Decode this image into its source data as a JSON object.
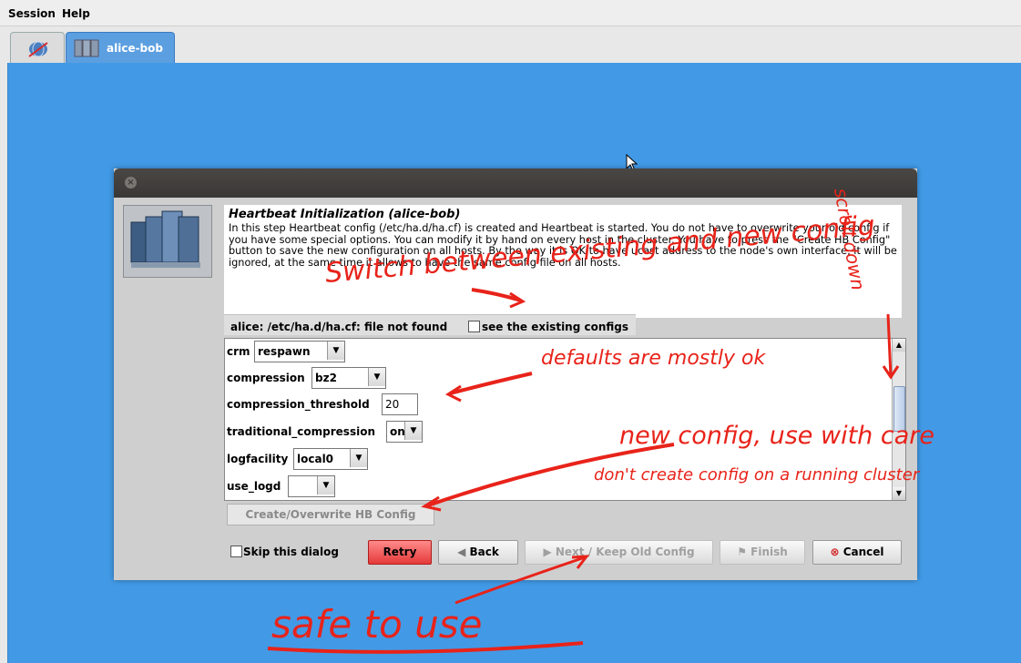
{
  "menu": {
    "session": "Session",
    "help": "Help"
  },
  "tabs": {
    "cluster_label": "alice-bob"
  },
  "dialog": {
    "title": "Heartbeat Initialization (alice-bob)",
    "description": "In this step Heartbeat config (/etc/ha.d/ha.cf) is created and Heartbeat is started. You do not have to overwrite your old config if you have some special options. You can modify it by hand on every host in the cluster. You have to press the \"Create HB Config\" button to save the new configuration on all hosts. By the way it is OK to have ucast address to the node's own interface, it will be ignored, at the same time it allows to have the same config file on all hosts.",
    "status": "alice: /etc/ha.d/ha.cf: file not found",
    "see_existing": "see the existing configs",
    "params": {
      "crm_label": "crm",
      "crm_value": "respawn",
      "compression_label": "compression",
      "compression_value": "bz2",
      "compression_threshold_label": "compression_threshold",
      "compression_threshold_value": "20",
      "traditional_compression_label": "traditional_compression",
      "traditional_compression_value": "on",
      "logfacility_label": "logfacility",
      "logfacility_value": "local0",
      "use_logd_label": "use_logd",
      "use_logd_value": ""
    },
    "create_button": "Create/Overwrite HB Config",
    "skip_label": "Skip this dialog",
    "buttons": {
      "retry": "Retry",
      "back": "Back",
      "next": "Next / Keep Old Config",
      "finish": "Finish",
      "cancel": "Cancel"
    }
  },
  "annotations": {
    "switch": "Switch between existing and new config",
    "scroll": "scroll down",
    "defaults": "defaults are mostly ok",
    "new_config": "new config, use with care",
    "dont_create": "don't create config on a running cluster",
    "safe": "safe to use"
  },
  "colors": {
    "main_bg": "#429ae6",
    "annotation": "#e8231a",
    "retry": "#e53a3a"
  }
}
